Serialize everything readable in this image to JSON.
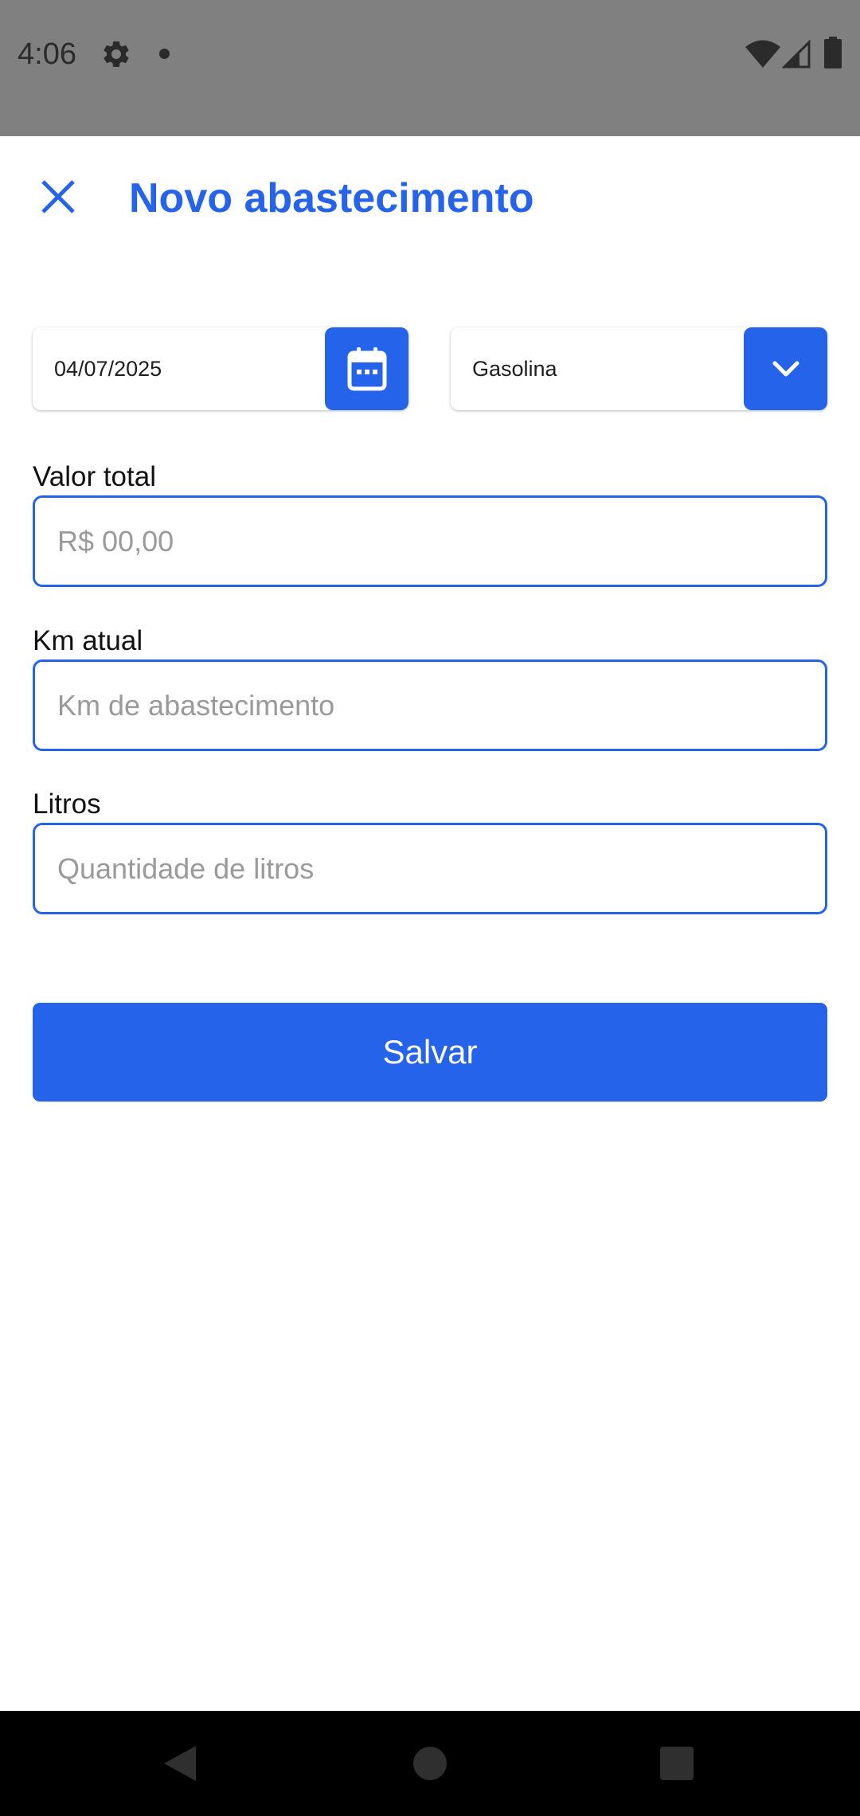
{
  "status_bar": {
    "time": "4:06",
    "icons": [
      "gear-icon",
      "notification-dot-icon",
      "wifi-icon",
      "signal-icon",
      "battery-icon"
    ]
  },
  "header": {
    "close_icon": "close-icon",
    "title": "Novo abastecimento"
  },
  "date_picker": {
    "value": "04/07/2025",
    "icon": "calendar-icon"
  },
  "fuel_select": {
    "value": "Gasolina",
    "icon": "chevron-down-icon"
  },
  "fields": {
    "valor_total": {
      "label": "Valor total",
      "value": "",
      "placeholder": "R$ 00,00"
    },
    "km_atual": {
      "label": "Km atual",
      "value": "",
      "placeholder": "Km de abastecimento"
    },
    "litros": {
      "label": "Litros",
      "value": "",
      "placeholder": "Quantidade de litros"
    }
  },
  "save_button": {
    "label": "Salvar"
  },
  "nav_bar": {
    "icons": [
      "back-icon",
      "home-icon",
      "recents-icon"
    ]
  },
  "colors": {
    "accent": "#2563eb",
    "status_bar": "#808080",
    "nav_bar": "#000000"
  }
}
